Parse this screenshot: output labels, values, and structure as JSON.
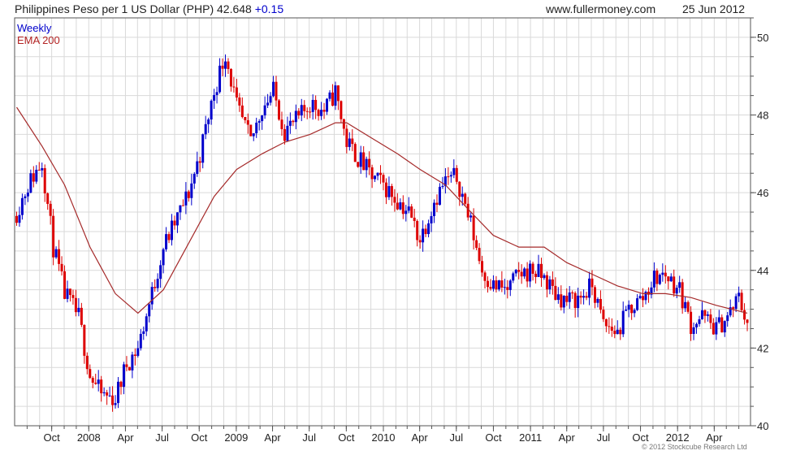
{
  "header": {
    "instrument": "Philippines Peso per 1 US Dollar (PHP) 42.648",
    "change": "+0.15",
    "website": "www.fullermoney.com",
    "date": "25 Jun 2012"
  },
  "legend": {
    "weekly": "Weekly",
    "ema": "EMA 200"
  },
  "copyright": "© 2012 Stockcube Research Ltd",
  "colors": {
    "up_candle": "#0000cc",
    "down_candle": "#dd0000",
    "ema_line": "#a52a2a",
    "grid": "#d9d9d9",
    "frame": "#555555"
  },
  "chart_data": {
    "type": "line",
    "title": "Philippines Peso per 1 US Dollar (PHP)",
    "xlabel": "",
    "ylabel": "",
    "ylim": [
      40,
      50.5
    ],
    "y_ticks": [
      "40",
      "42",
      "44",
      "46",
      "48",
      "50"
    ],
    "x_ticks": [
      "Oct",
      "2008",
      "Apr",
      "Jul",
      "Oct",
      "2009",
      "Apr",
      "Jul",
      "Oct",
      "2010",
      "Apr",
      "Jul",
      "Oct",
      "2011",
      "Apr",
      "Jul",
      "Oct",
      "2012",
      "Apr"
    ],
    "x_tick_dates": [
      "2007-10-01",
      "2008-01-01",
      "2008-04-01",
      "2008-07-01",
      "2008-10-01",
      "2009-01-01",
      "2009-04-01",
      "2009-07-01",
      "2009-10-01",
      "2010-01-01",
      "2010-04-01",
      "2010-07-01",
      "2010-10-01",
      "2011-01-01",
      "2011-04-01",
      "2011-07-01",
      "2011-10-01",
      "2012-01-01",
      "2012-04-01"
    ],
    "x_range": [
      "2007-07-01",
      "2012-06-30"
    ],
    "grid": true,
    "legend_position": "top-left",
    "series": [
      {
        "name": "Weekly",
        "style": "candlestick",
        "x": [
          "2007-07-06",
          "2007-08-03",
          "2007-09-07",
          "2007-10-05",
          "2007-11-02",
          "2007-12-07",
          "2008-01-04",
          "2008-02-01",
          "2008-03-07",
          "2008-04-04",
          "2008-05-02",
          "2008-06-06",
          "2008-07-04",
          "2008-08-01",
          "2008-09-05",
          "2008-10-03",
          "2008-11-07",
          "2008-12-05",
          "2009-01-02",
          "2009-02-06",
          "2009-03-06",
          "2009-04-03",
          "2009-05-01",
          "2009-06-05",
          "2009-07-03",
          "2009-08-07",
          "2009-09-04",
          "2009-10-02",
          "2009-11-06",
          "2009-12-04",
          "2010-01-01",
          "2010-02-05",
          "2010-03-05",
          "2010-04-02",
          "2010-05-07",
          "2010-06-04",
          "2010-07-02",
          "2010-08-06",
          "2010-09-03",
          "2010-10-01",
          "2010-11-05",
          "2010-12-03",
          "2011-01-07",
          "2011-02-04",
          "2011-03-04",
          "2011-04-01",
          "2011-05-06",
          "2011-06-03",
          "2011-07-01",
          "2011-08-05",
          "2011-09-02",
          "2011-10-07",
          "2011-11-04",
          "2011-12-02",
          "2012-01-06",
          "2012-02-03",
          "2012-03-02",
          "2012-04-06",
          "2012-05-04",
          "2012-06-01",
          "2012-06-22"
        ],
        "values": [
          45.5,
          46.2,
          46.8,
          44.6,
          43.4,
          42.8,
          41.3,
          40.8,
          40.7,
          41.6,
          42.0,
          43.4,
          44.6,
          45.2,
          46.0,
          47.0,
          48.6,
          49.6,
          48.2,
          47.3,
          48.2,
          48.6,
          47.6,
          47.9,
          48.3,
          48.1,
          48.6,
          47.3,
          46.8,
          46.4,
          46.2,
          45.8,
          45.5,
          44.8,
          45.8,
          46.3,
          46.4,
          45.2,
          44.0,
          43.6,
          43.5,
          43.9,
          44.0,
          43.8,
          43.4,
          43.2,
          43.3,
          43.6,
          42.6,
          42.4,
          43.0,
          43.3,
          43.8,
          43.9,
          43.5,
          42.6,
          42.8,
          42.5,
          42.8,
          43.3,
          42.648
        ]
      },
      {
        "name": "EMA 200",
        "style": "line",
        "x": [
          "2007-07-06",
          "2007-09-07",
          "2007-11-02",
          "2008-01-04",
          "2008-03-07",
          "2008-05-02",
          "2008-07-04",
          "2008-09-05",
          "2008-11-07",
          "2009-01-02",
          "2009-03-06",
          "2009-05-01",
          "2009-07-03",
          "2009-09-04",
          "2009-10-02",
          "2009-12-04",
          "2010-02-05",
          "2010-04-02",
          "2010-06-04",
          "2010-08-06",
          "2010-10-01",
          "2010-12-03",
          "2011-02-04",
          "2011-04-01",
          "2011-06-03",
          "2011-08-05",
          "2011-10-07",
          "2011-12-02",
          "2012-02-03",
          "2012-04-06",
          "2012-06-22"
        ],
        "values": [
          48.2,
          47.2,
          46.2,
          44.6,
          43.4,
          42.9,
          43.5,
          44.7,
          45.9,
          46.6,
          47.0,
          47.3,
          47.5,
          47.8,
          47.8,
          47.4,
          47.0,
          46.6,
          46.2,
          45.5,
          44.9,
          44.6,
          44.6,
          44.2,
          43.9,
          43.6,
          43.4,
          43.4,
          43.3,
          43.1,
          42.9
        ]
      }
    ]
  }
}
